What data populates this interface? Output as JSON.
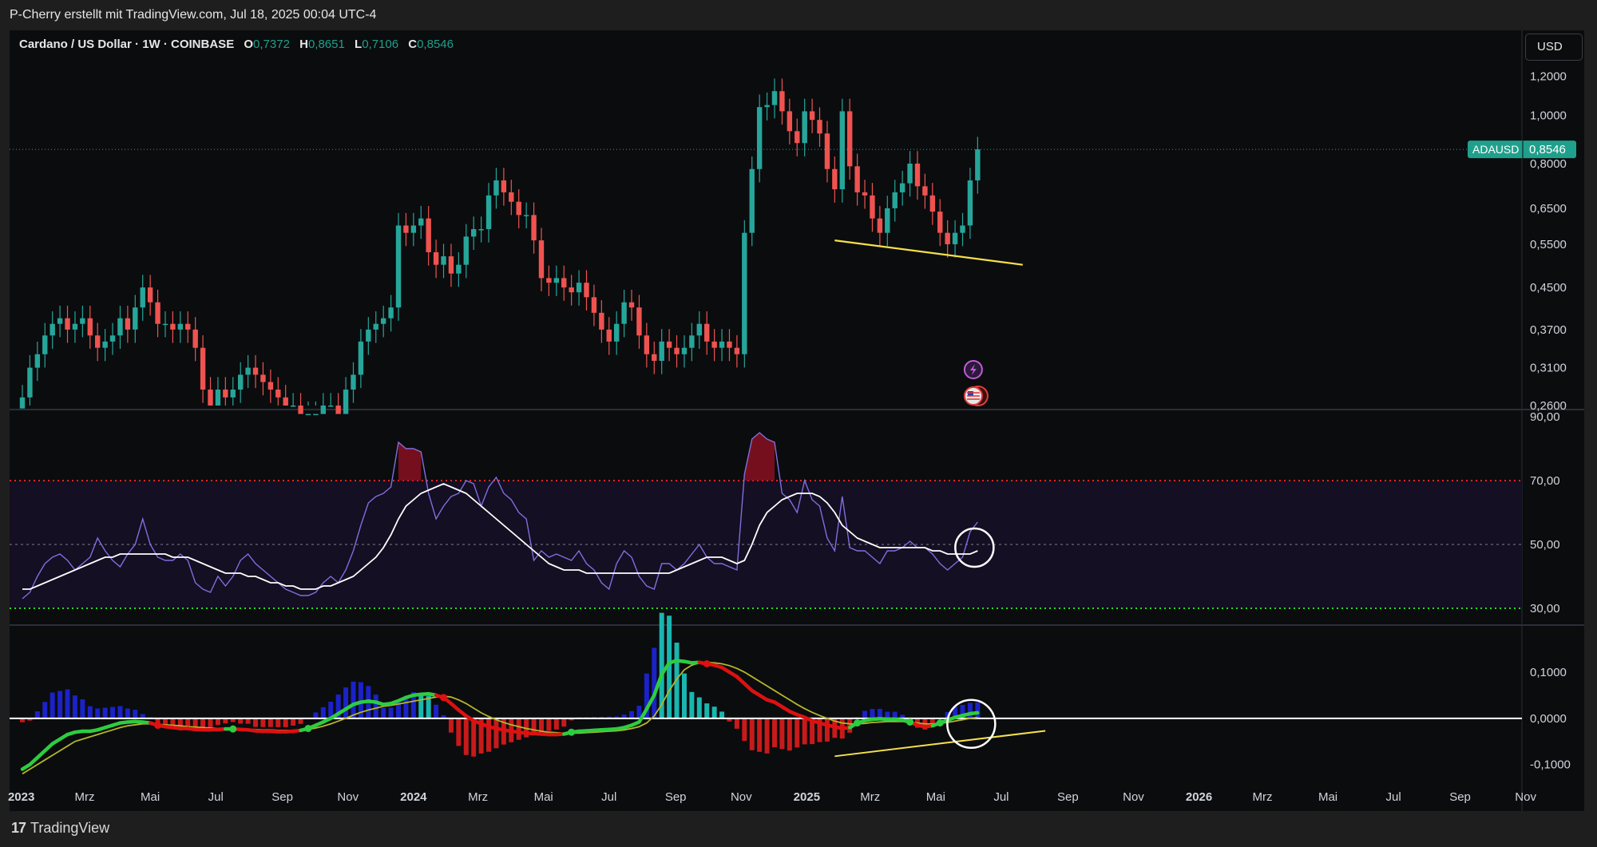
{
  "header": {
    "attribution": "P-Cherry erstellt mit TradingView.com, Jul 18, 2025 00:04 UTC-4"
  },
  "legend": {
    "symbol_line": "Cardano / US Dollar · 1W · COINBASE",
    "o_label": "O",
    "o_value": "0,7372",
    "h_label": "H",
    "h_value": "0,8651",
    "l_label": "L",
    "l_value": "0,7106",
    "c_label": "C",
    "c_value": "0,8546"
  },
  "currency_button": "USD",
  "price_tag": {
    "symbol": "ADAUSD",
    "value": "0,8546"
  },
  "footer": {
    "logo": "17",
    "brand": "TradingView"
  },
  "colors": {
    "up": "#26a69a",
    "down": "#ef5350",
    "rsi": "#7e6fe0",
    "rsi_ma": "#ffffff",
    "overbought": "#ff2222",
    "oversold": "#22dd22",
    "trendline": "#f5e04a",
    "macd_up": "#2ecc40",
    "macd_down": "#dd1111",
    "signal": "#b5b52a",
    "hist_pos": "#1a22c8",
    "hist_neg": "#c81a1a",
    "price_tag_bg": "#1fa08c"
  },
  "icons": [
    "lightning-event-icon",
    "us-flag-event-icon"
  ],
  "chart_data": [
    {
      "type": "candlestick",
      "title": "Cardano / US Dollar · 1W · COINBASE",
      "y_scale": "log",
      "ylim": [
        0.26,
        1.3
      ],
      "y_ticks": [
        "1,2000",
        "1,0000",
        "0,8000",
        "0,6500",
        "0,5500",
        "0,4500",
        "0,3700",
        "0,3100",
        "0,2600"
      ],
      "y_tick_values": [
        1.2,
        1.0,
        0.8,
        0.65,
        0.55,
        0.45,
        0.37,
        0.31,
        0.26
      ],
      "x_ticks": [
        "2023",
        "Mrz",
        "Mai",
        "Jul",
        "Sep",
        "Nov",
        "2024",
        "Mrz",
        "Mai",
        "Jul",
        "Sep",
        "Nov",
        "2025",
        "Mrz",
        "Mai",
        "Jul",
        "Sep",
        "Nov",
        "2026",
        "Mrz",
        "Mai",
        "Jul",
        "Sep",
        "Nov"
      ],
      "bold_x_ticks": [
        "2023",
        "2024",
        "2025",
        "2026"
      ],
      "last_price": 0.8546,
      "close_series": [
        0.27,
        0.31,
        0.33,
        0.36,
        0.38,
        0.39,
        0.37,
        0.38,
        0.39,
        0.36,
        0.34,
        0.35,
        0.36,
        0.39,
        0.37,
        0.41,
        0.45,
        0.42,
        0.38,
        0.38,
        0.37,
        0.38,
        0.37,
        0.34,
        0.28,
        0.26,
        0.28,
        0.27,
        0.28,
        0.3,
        0.31,
        0.3,
        0.29,
        0.28,
        0.27,
        0.26,
        0.26,
        0.25,
        0.25,
        0.25,
        0.26,
        0.26,
        0.25,
        0.28,
        0.3,
        0.35,
        0.37,
        0.38,
        0.39,
        0.41,
        0.6,
        0.58,
        0.6,
        0.62,
        0.53,
        0.5,
        0.52,
        0.48,
        0.5,
        0.57,
        0.59,
        0.59,
        0.69,
        0.74,
        0.7,
        0.67,
        0.63,
        0.63,
        0.56,
        0.47,
        0.46,
        0.47,
        0.45,
        0.44,
        0.46,
        0.43,
        0.4,
        0.37,
        0.35,
        0.38,
        0.42,
        0.41,
        0.36,
        0.33,
        0.32,
        0.35,
        0.34,
        0.33,
        0.34,
        0.36,
        0.38,
        0.35,
        0.34,
        0.35,
        0.34,
        0.33,
        0.58,
        0.78,
        1.04,
        1.05,
        1.12,
        1.02,
        0.93,
        0.88,
        1.02,
        0.98,
        0.92,
        0.78,
        0.71,
        1.02,
        0.79,
        0.7,
        0.69,
        0.62,
        0.58,
        0.65,
        0.7,
        0.73,
        0.8,
        0.72,
        0.69,
        0.64,
        0.58,
        0.55,
        0.58,
        0.6,
        0.74,
        0.8546
      ],
      "trendline": {
        "from": {
          "x": "2025-01-27",
          "y": 0.56
        },
        "to": {
          "x": "2025-07-21",
          "y": 0.5
        }
      }
    },
    {
      "type": "line",
      "series": [
        {
          "values": [
            33,
            35,
            40,
            44,
            46,
            47,
            45,
            42,
            44,
            46,
            52,
            48,
            45,
            43,
            47,
            50,
            58,
            50,
            46,
            45,
            45,
            47,
            45,
            38,
            36,
            35,
            40,
            37,
            40,
            45,
            47,
            44,
            42,
            40,
            38,
            36,
            35,
            34,
            34,
            35,
            38,
            40,
            38,
            42,
            48,
            56,
            63,
            65,
            66,
            68,
            82,
            80,
            80,
            79,
            66,
            58,
            62,
            65,
            66,
            70,
            69,
            62,
            68,
            71,
            66,
            64,
            60,
            58,
            45,
            48,
            46,
            47,
            46,
            45,
            48,
            44,
            42,
            38,
            36,
            44,
            48,
            46,
            40,
            37,
            36,
            44,
            44,
            42,
            44,
            47,
            50,
            46,
            44,
            44,
            43,
            42,
            72,
            83,
            85,
            83,
            82,
            66,
            64,
            60,
            70,
            64,
            62,
            52,
            48,
            65,
            49,
            48,
            48,
            46,
            44,
            48,
            48,
            49,
            51,
            49,
            49,
            47,
            44,
            42,
            44,
            46,
            54,
            57
          ]
        },
        {
          "values": [
            36,
            36,
            37,
            38,
            39,
            40,
            41,
            42,
            43,
            44,
            45,
            46,
            46,
            47,
            47,
            47,
            47,
            47,
            47,
            47,
            46,
            46,
            46,
            45,
            44,
            43,
            42,
            41,
            41,
            41,
            40,
            40,
            39,
            38,
            38,
            37,
            37,
            36,
            36,
            36,
            37,
            37,
            38,
            39,
            40,
            42,
            44,
            46,
            49,
            53,
            58,
            62,
            64,
            66,
            67,
            68,
            69,
            68,
            67,
            66,
            64,
            62,
            60,
            58,
            56,
            54,
            52,
            50,
            48,
            46,
            44,
            43,
            42,
            42,
            42,
            41,
            41,
            41,
            41,
            41,
            41,
            41,
            41,
            41,
            41,
            41,
            41,
            42,
            43,
            44,
            45,
            46,
            46,
            46,
            45,
            44,
            45,
            50,
            56,
            60,
            62,
            64,
            65,
            66,
            66,
            66,
            65,
            63,
            60,
            56,
            54,
            52,
            51,
            50,
            49,
            49,
            49,
            49,
            49,
            49,
            49,
            48,
            48,
            47,
            47,
            47,
            47,
            48
          ]
        }
      ],
      "ylim": [
        25,
        92
      ],
      "y_ticks": [
        "90,00",
        "70,00",
        "50,00",
        "30,00"
      ],
      "y_tick_values": [
        90,
        70,
        50,
        30
      ],
      "levels": [
        70,
        50,
        30
      ]
    },
    {
      "type": "line",
      "series": [
        {
          "values": [
            -0.11,
            -0.1,
            -0.085,
            -0.07,
            -0.055,
            -0.045,
            -0.035,
            -0.03,
            -0.028,
            -0.028,
            -0.025,
            -0.02,
            -0.015,
            -0.01,
            -0.008,
            -0.007,
            -0.008,
            -0.01,
            -0.015,
            -0.018,
            -0.02,
            -0.022,
            -0.022,
            -0.024,
            -0.025,
            -0.025,
            -0.024,
            -0.023,
            -0.023,
            -0.024,
            -0.025,
            -0.027,
            -0.028,
            -0.028,
            -0.029,
            -0.029,
            -0.028,
            -0.026,
            -0.022,
            -0.015,
            -0.008,
            0.0,
            0.01,
            0.02,
            0.03,
            0.035,
            0.037,
            0.035,
            0.03,
            0.032,
            0.038,
            0.045,
            0.05,
            0.052,
            0.053,
            0.05,
            0.045,
            0.032,
            0.018,
            0.005,
            -0.005,
            -0.012,
            -0.018,
            -0.022,
            -0.025,
            -0.028,
            -0.03,
            -0.032,
            -0.033,
            -0.034,
            -0.035,
            -0.035,
            -0.034,
            -0.03,
            -0.028,
            -0.027,
            -0.026,
            -0.025,
            -0.024,
            -0.023,
            -0.02,
            -0.015,
            -0.008,
            0.02,
            0.05,
            0.095,
            0.12,
            0.125,
            0.123,
            0.12,
            0.121,
            0.118,
            0.115,
            0.11,
            0.1,
            0.09,
            0.075,
            0.06,
            0.05,
            0.04,
            0.035,
            0.025,
            0.015,
            0.008,
            0.002,
            -0.005,
            -0.01,
            -0.015,
            -0.018,
            -0.022,
            -0.02,
            -0.01,
            -0.005,
            -0.002,
            -0.001,
            -0.002,
            -0.002,
            -0.004,
            -0.008,
            -0.015,
            -0.018,
            -0.016,
            -0.01,
            -0.004,
            0.002,
            0.006,
            0.01,
            0.012
          ]
        },
        {
          "values": [
            -0.12,
            -0.11,
            -0.1,
            -0.09,
            -0.08,
            -0.07,
            -0.06,
            -0.05,
            -0.045,
            -0.04,
            -0.035,
            -0.03,
            -0.025,
            -0.02,
            -0.016,
            -0.014,
            -0.012,
            -0.012,
            -0.013,
            -0.014,
            -0.015,
            -0.016,
            -0.018,
            -0.019,
            -0.02,
            -0.021,
            -0.022,
            -0.022,
            -0.023,
            -0.023,
            -0.024,
            -0.024,
            -0.025,
            -0.025,
            -0.026,
            -0.026,
            -0.026,
            -0.025,
            -0.024,
            -0.021,
            -0.017,
            -0.012,
            -0.006,
            0.0,
            0.007,
            0.013,
            0.018,
            0.022,
            0.026,
            0.028,
            0.031,
            0.034,
            0.037,
            0.04,
            0.043,
            0.046,
            0.048,
            0.046,
            0.04,
            0.032,
            0.022,
            0.012,
            0.004,
            -0.003,
            -0.009,
            -0.014,
            -0.018,
            -0.022,
            -0.025,
            -0.028,
            -0.03,
            -0.031,
            -0.032,
            -0.032,
            -0.032,
            -0.031,
            -0.03,
            -0.029,
            -0.028,
            -0.027,
            -0.025,
            -0.022,
            -0.018,
            -0.01,
            0.005,
            0.03,
            0.06,
            0.085,
            0.105,
            0.115,
            0.12,
            0.121,
            0.12,
            0.118,
            0.114,
            0.108,
            0.1,
            0.09,
            0.08,
            0.07,
            0.06,
            0.05,
            0.04,
            0.03,
            0.021,
            0.013,
            0.006,
            0.0,
            -0.006,
            -0.01,
            -0.012,
            -0.012,
            -0.011,
            -0.009,
            -0.008,
            -0.007,
            -0.007,
            -0.007,
            -0.008,
            -0.01,
            -0.012,
            -0.012,
            -0.011,
            -0.009,
            -0.006,
            -0.003,
            0.0,
            0.002
          ]
        }
      ],
      "ylim": [
        -0.135,
        0.2
      ],
      "y_ticks": [
        "0,1000",
        "0,0000",
        "-0,1000"
      ],
      "y_tick_values": [
        0.1,
        0.0,
        -0.1
      ],
      "trendline": {
        "from": {
          "x": "2025-01-27",
          "y": -0.082
        },
        "to": {
          "x": "2025-08-11",
          "y": -0.027
        }
      }
    }
  ]
}
